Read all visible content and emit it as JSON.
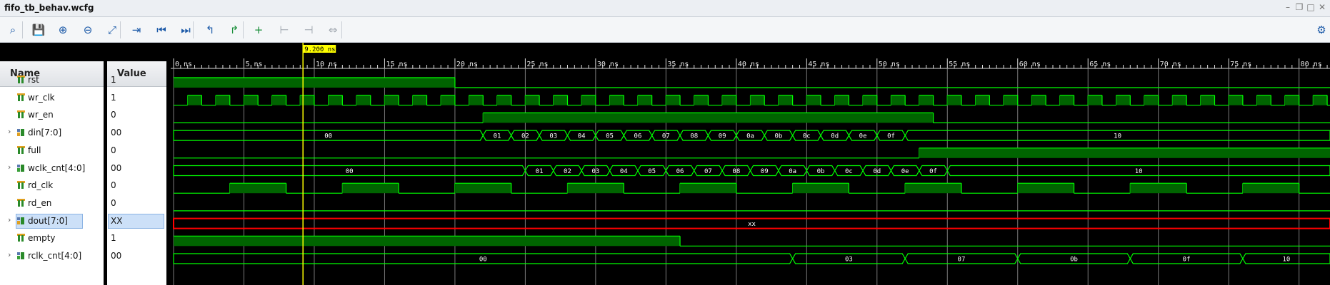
{
  "window": {
    "title": "fifo_tb_behav.wcfg",
    "controls": [
      "minimize-icon",
      "restore-icon",
      "maximize-icon",
      "close-icon"
    ]
  },
  "toolbar": {
    "buttons": [
      {
        "name": "search-button",
        "icon": "search-icon",
        "glyph": "⌕"
      },
      {
        "name": "save-button",
        "icon": "save-icon",
        "glyph": "💾"
      },
      {
        "name": "zoom-in-button",
        "icon": "zoom-in-icon",
        "glyph": "⊕"
      },
      {
        "name": "zoom-out-button",
        "icon": "zoom-out-icon",
        "glyph": "⊖"
      },
      {
        "name": "zoom-fit-button",
        "icon": "zoom-fit-icon",
        "glyph": "⤢"
      },
      {
        "name": "go-to-cursor-button",
        "icon": "go-to-cursor-icon",
        "glyph": "⇥"
      },
      {
        "name": "go-to-start-button",
        "icon": "go-to-start-icon",
        "glyph": "⏮"
      },
      {
        "name": "go-to-end-button",
        "icon": "go-to-end-icon",
        "glyph": "⏭"
      },
      {
        "name": "previous-transition-button",
        "icon": "previous-transition-icon",
        "glyph": "↰"
      },
      {
        "name": "next-transition-button",
        "icon": "next-transition-icon",
        "glyph": "↱"
      },
      {
        "name": "add-marker-button",
        "icon": "add-marker-icon",
        "glyph": "+"
      },
      {
        "name": "previous-marker-button",
        "icon": "previous-marker-icon",
        "glyph": "⊢"
      },
      {
        "name": "next-marker-button",
        "icon": "next-marker-icon",
        "glyph": "⊣"
      },
      {
        "name": "swap-cursors-button",
        "icon": "swap-cursors-icon",
        "glyph": "⇔"
      },
      {
        "name": "settings-button",
        "icon": "gear-icon",
        "glyph": "⚙"
      }
    ]
  },
  "headers": {
    "name": "Name",
    "value": "Value"
  },
  "cursor": {
    "label": "9.200 ns",
    "time_ns": 9.2
  },
  "timeline": {
    "start_ns": 0,
    "end_ns": 82.2,
    "tick_labels": [
      "0 ns",
      "5 ns",
      "10 ns",
      "15 ns",
      "20 ns",
      "25 ns",
      "30 ns",
      "35 ns",
      "40 ns",
      "45 ns",
      "50 ns",
      "55 ns",
      "60 ns",
      "65 ns",
      "70 ns",
      "75 ns",
      "80 ns"
    ],
    "major_step_ns": 5
  },
  "colors": {
    "wave": "#00ff00",
    "wave_fill": "#006400",
    "cursor": "#ffff00",
    "cursor_label_bg": "#ffff00",
    "bus_x": "#ff0000",
    "gridline": "#7a7a7a",
    "background": "#000000"
  },
  "signals": [
    {
      "name": "rst",
      "value": "1",
      "kind": "bit",
      "expandable": false
    },
    {
      "name": "wr_clk",
      "value": "1",
      "kind": "bit",
      "expandable": false
    },
    {
      "name": "wr_en",
      "value": "0",
      "kind": "bit",
      "expandable": false
    },
    {
      "name": "din[7:0]",
      "value": "00",
      "kind": "bus",
      "expandable": true
    },
    {
      "name": "full",
      "value": "0",
      "kind": "bit",
      "expandable": false
    },
    {
      "name": "wclk_cnt[4:0]",
      "value": "00",
      "kind": "busg",
      "expandable": true
    },
    {
      "name": "rd_clk",
      "value": "0",
      "kind": "bit",
      "expandable": false
    },
    {
      "name": "rd_en",
      "value": "0",
      "kind": "bit",
      "expandable": false
    },
    {
      "name": "dout[7:0]",
      "value": "XX",
      "kind": "bus",
      "expandable": true,
      "selected": true
    },
    {
      "name": "empty",
      "value": "1",
      "kind": "bit",
      "expandable": false
    },
    {
      "name": "rclk_cnt[4:0]",
      "value": "00",
      "kind": "busg",
      "expandable": true
    }
  ],
  "waves": [
    {
      "signal": "rst",
      "type": "bit",
      "init": 1,
      "edges_ns": [
        20
      ]
    },
    {
      "signal": "wr_clk",
      "type": "clock",
      "period_ns": 2,
      "first_rise_ns": 1,
      "duty": 0.5
    },
    {
      "signal": "wr_en",
      "type": "bit",
      "init": 0,
      "edges_ns": [
        22,
        54
      ]
    },
    {
      "signal": "din[7:0]",
      "type": "bus",
      "segments": [
        {
          "start": 0,
          "end": 22,
          "label": "00"
        },
        {
          "start": 22,
          "end": 24,
          "label": "01"
        },
        {
          "start": 24,
          "end": 26,
          "label": "02"
        },
        {
          "start": 26,
          "end": 28,
          "label": "03"
        },
        {
          "start": 28,
          "end": 30,
          "label": "04"
        },
        {
          "start": 30,
          "end": 32,
          "label": "05"
        },
        {
          "start": 32,
          "end": 34,
          "label": "06"
        },
        {
          "start": 34,
          "end": 36,
          "label": "07"
        },
        {
          "start": 36,
          "end": 38,
          "label": "08"
        },
        {
          "start": 38,
          "end": 40,
          "label": "09"
        },
        {
          "start": 40,
          "end": 42,
          "label": "0a"
        },
        {
          "start": 42,
          "end": 44,
          "label": "0b"
        },
        {
          "start": 44,
          "end": 46,
          "label": "0c"
        },
        {
          "start": 46,
          "end": 48,
          "label": "0d"
        },
        {
          "start": 48,
          "end": 50,
          "label": "0e"
        },
        {
          "start": 50,
          "end": 52,
          "label": "0f"
        },
        {
          "start": 52,
          "end": 82.2,
          "label": "10"
        }
      ]
    },
    {
      "signal": "full",
      "type": "bit",
      "init": 0,
      "edges_ns": [
        53
      ]
    },
    {
      "signal": "wclk_cnt[4:0]",
      "type": "bus",
      "segments": [
        {
          "start": 0,
          "end": 25,
          "label": "00"
        },
        {
          "start": 25,
          "end": 27,
          "label": "01"
        },
        {
          "start": 27,
          "end": 29,
          "label": "02"
        },
        {
          "start": 29,
          "end": 31,
          "label": "03"
        },
        {
          "start": 31,
          "end": 33,
          "label": "04"
        },
        {
          "start": 33,
          "end": 35,
          "label": "05"
        },
        {
          "start": 35,
          "end": 37,
          "label": "06"
        },
        {
          "start": 37,
          "end": 39,
          "label": "07"
        },
        {
          "start": 39,
          "end": 41,
          "label": "08"
        },
        {
          "start": 41,
          "end": 43,
          "label": "09"
        },
        {
          "start": 43,
          "end": 45,
          "label": "0a"
        },
        {
          "start": 45,
          "end": 47,
          "label": "0b"
        },
        {
          "start": 47,
          "end": 49,
          "label": "0c"
        },
        {
          "start": 49,
          "end": 51,
          "label": "0d"
        },
        {
          "start": 51,
          "end": 53,
          "label": "0e"
        },
        {
          "start": 53,
          "end": 55,
          "label": "0f"
        },
        {
          "start": 55,
          "end": 82.2,
          "label": "10"
        }
      ]
    },
    {
      "signal": "rd_clk",
      "type": "clock",
      "period_ns": 8,
      "first_rise_ns": 4,
      "duty": 0.5
    },
    {
      "signal": "rd_en",
      "type": "bit",
      "init": 0,
      "edges_ns": []
    },
    {
      "signal": "dout[7:0]",
      "type": "bus_x",
      "segments": [
        {
          "start": 0,
          "end": 82.2,
          "label": "XX"
        }
      ]
    },
    {
      "signal": "empty",
      "type": "bit",
      "init": 1,
      "edges_ns": [
        36
      ]
    },
    {
      "signal": "rclk_cnt[4:0]",
      "type": "bus",
      "segments": [
        {
          "start": 0,
          "end": 44,
          "label": "00"
        },
        {
          "start": 44,
          "end": 52,
          "label": "03"
        },
        {
          "start": 52,
          "end": 60,
          "label": "07"
        },
        {
          "start": 60,
          "end": 68,
          "label": "0b"
        },
        {
          "start": 68,
          "end": 76,
          "label": "0f"
        },
        {
          "start": 76,
          "end": 82.2,
          "label": "10"
        }
      ]
    }
  ]
}
